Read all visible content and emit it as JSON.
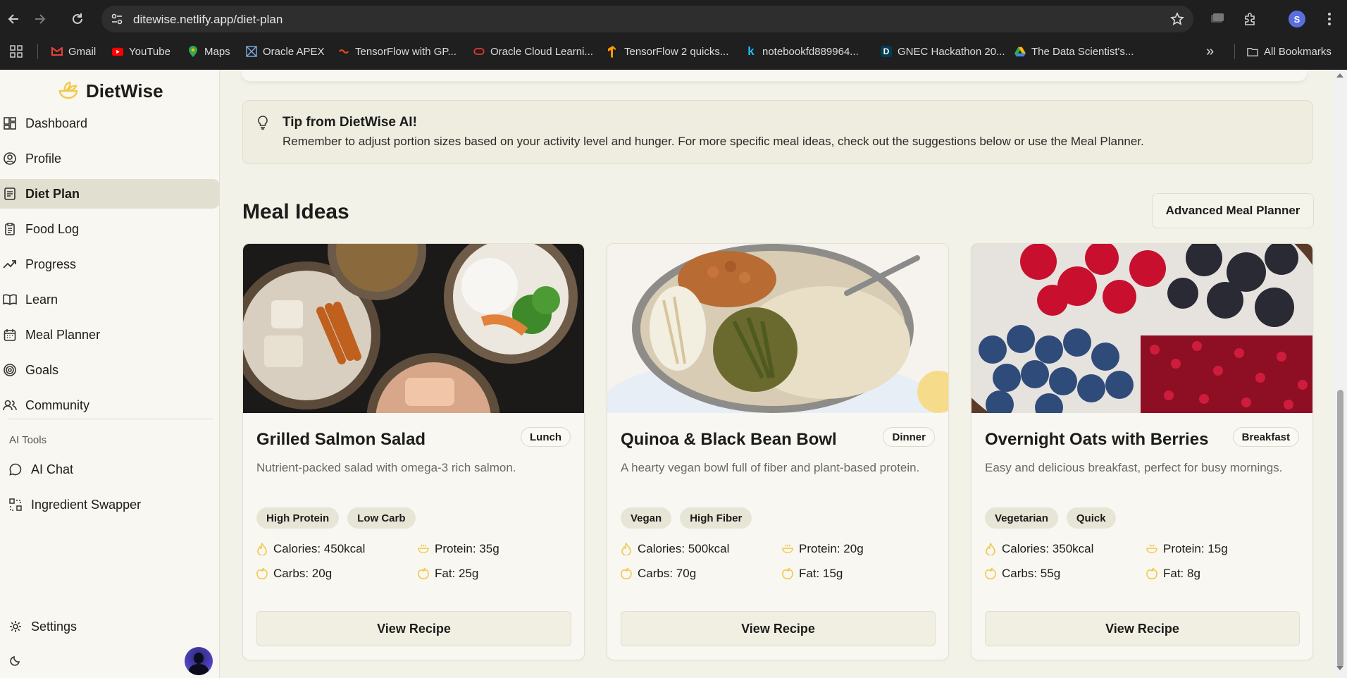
{
  "browser": {
    "url": "ditewise.netlify.app/diet-plan",
    "profile_initial": "S",
    "bookmarks": [
      {
        "label": "Gmail",
        "icon": "gmail-icon",
        "color": "#ea4335"
      },
      {
        "label": "YouTube",
        "icon": "youtube-icon",
        "color": "#ff0000"
      },
      {
        "label": "Maps",
        "icon": "maps-icon",
        "color": "#34a853"
      },
      {
        "label": "Oracle APEX",
        "icon": "oracle-apex-icon",
        "color": "#7aa7d9"
      },
      {
        "label": "TensorFlow with GP...",
        "icon": "tensorflow-icon",
        "color": "#e64a19"
      },
      {
        "label": "Oracle Cloud Learni...",
        "icon": "oracle-icon",
        "color": "#e53935"
      },
      {
        "label": "TensorFlow 2 quicks...",
        "icon": "tensorflow-icon",
        "color": "#ff9800"
      },
      {
        "label": "notebookfd889964...",
        "icon": "kaggle-icon",
        "color": "#20beff"
      },
      {
        "label": "GNEC Hackathon 20...",
        "icon": "devpost-icon",
        "color": "#003e54"
      },
      {
        "label": "The Data Scientist's...",
        "icon": "google-drive-icon",
        "color": "#fbbc04"
      }
    ],
    "more_bookmarks": "»",
    "all_bookmarks": "All Bookmarks"
  },
  "sidebar": {
    "brand": "DietWise",
    "nav": [
      {
        "label": "Dashboard",
        "icon": "dashboard-icon"
      },
      {
        "label": "Profile",
        "icon": "profile-icon"
      },
      {
        "label": "Diet Plan",
        "icon": "diet-plan-icon"
      },
      {
        "label": "Food Log",
        "icon": "food-log-icon"
      },
      {
        "label": "Progress",
        "icon": "progress-icon"
      },
      {
        "label": "Learn",
        "icon": "book-icon"
      },
      {
        "label": "Meal Planner",
        "icon": "calendar-icon"
      },
      {
        "label": "Goals",
        "icon": "target-icon"
      },
      {
        "label": "Community",
        "icon": "community-icon"
      }
    ],
    "active": "Diet Plan",
    "tools_label": "AI Tools",
    "tools": [
      {
        "label": "AI Chat",
        "icon": "chat-icon"
      },
      {
        "label": "Ingredient Swapper",
        "icon": "swap-icon"
      }
    ],
    "settings": "Settings",
    "theme_icon": "moon-icon"
  },
  "tip": {
    "title": "Tip from DietWise AI!",
    "body": "Remember to adjust portion sizes based on your activity level and hunger. For more specific meal ideas, check out the suggestions below or use the Meal Planner."
  },
  "meal_ideas": {
    "title": "Meal Ideas",
    "advanced_button": "Advanced Meal Planner",
    "cards": [
      {
        "title": "Grilled Salmon Salad",
        "badge": "Lunch",
        "description": "Nutrient-packed salad with omega-3 rich salmon.",
        "tags": [
          "High Protein",
          "Low Carb"
        ],
        "calories": "Calories: 450kcal",
        "protein": "Protein: 35g",
        "carbs": "Carbs: 20g",
        "fat": "Fat: 25g",
        "button": "View Recipe"
      },
      {
        "title": "Quinoa & Black Bean Bowl",
        "badge": "Dinner",
        "description": "A hearty vegan bowl full of fiber and plant-based protein.",
        "tags": [
          "Vegan",
          "High Fiber"
        ],
        "calories": "Calories: 500kcal",
        "protein": "Protein: 20g",
        "carbs": "Carbs: 70g",
        "fat": "Fat: 15g",
        "button": "View Recipe"
      },
      {
        "title": "Overnight Oats with Berries",
        "badge": "Breakfast",
        "description": "Easy and delicious breakfast, perfect for busy mornings.",
        "tags": [
          "Vegetarian",
          "Quick"
        ],
        "calories": "Calories: 350kcal",
        "protein": "Protein: 15g",
        "carbs": "Carbs: 55g",
        "fat": "Fat: 8g",
        "button": "View Recipe"
      }
    ]
  },
  "colors": {
    "accent": "#f2c94c",
    "background": "#f3f2e8",
    "sidebar_active": "#e1e0d0"
  }
}
